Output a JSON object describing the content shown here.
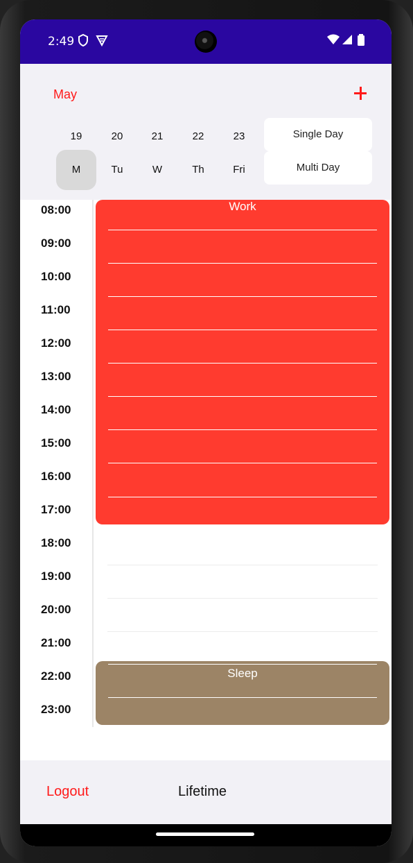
{
  "status": {
    "time": "2:49"
  },
  "header": {
    "month": "May"
  },
  "dates": [
    "19",
    "20",
    "21",
    "22",
    "23"
  ],
  "weekdays": [
    "M",
    "Tu",
    "W",
    "Th",
    "Fri"
  ],
  "modes": {
    "single": "Single Day",
    "multi": "Multi Day"
  },
  "times": [
    "08:00",
    "09:00",
    "10:00",
    "11:00",
    "12:00",
    "13:00",
    "14:00",
    "15:00",
    "16:00",
    "17:00",
    "18:00",
    "19:00",
    "20:00",
    "21:00",
    "22:00",
    "23:00"
  ],
  "events": {
    "work": {
      "title": "Work",
      "color": "#ff3b2f"
    },
    "sleep": {
      "title": "Sleep",
      "color": "#9c8466"
    }
  },
  "footer": {
    "logout": "Logout",
    "lifetime": "Lifetime"
  },
  "colors": {
    "accent": "#ff1a1a",
    "statusbar": "#2a07a0"
  }
}
